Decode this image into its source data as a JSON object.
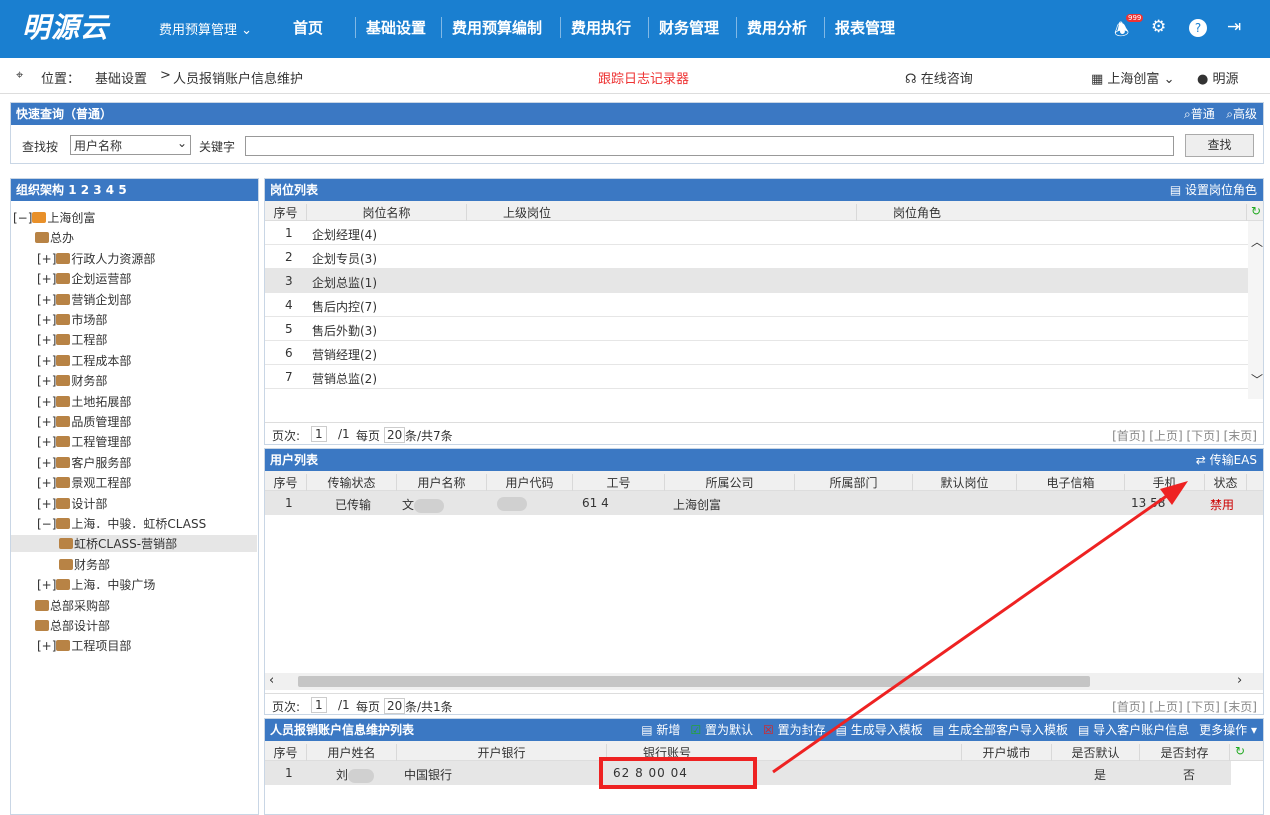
{
  "header": {
    "logo": "明源云",
    "module_menu": "费用预算管理",
    "nav": [
      "首页",
      "基础设置",
      "费用预算编制",
      "费用执行",
      "财务管理",
      "费用分析",
      "报表管理"
    ],
    "notification_count": "999",
    "icons": [
      "bell-icon",
      "gear-icon",
      "help-icon",
      "logout-icon"
    ]
  },
  "location": {
    "label": "位置：",
    "crumb1": "基础设置",
    "sep": ">",
    "crumb2": "人员报销账户信息维护",
    "log_link": "跟踪日志记录器",
    "consult": "在线咨询",
    "company": "上海创富",
    "user": "明源"
  },
  "quick": {
    "title": "快速查询（普通）",
    "normal": "普通",
    "advanced": "高级",
    "search_by": "查找按",
    "search_field": "用户名称",
    "keyword": "关键字",
    "keyword_value": "",
    "search_btn": "查找"
  },
  "org": {
    "title": "组织架构",
    "levels": "1 2 3 4 5",
    "tree": [
      {
        "label": "上海创富",
        "toggle": "[−]"
      },
      {
        "label": "总办",
        "toggle": ""
      },
      {
        "label": "行政人力资源部",
        "toggle": "[+]"
      },
      {
        "label": "企划运营部",
        "toggle": "[+]"
      },
      {
        "label": "营销企划部",
        "toggle": "[+]"
      },
      {
        "label": "市场部",
        "toggle": "[+]"
      },
      {
        "label": "工程部",
        "toggle": "[+]"
      },
      {
        "label": "工程成本部",
        "toggle": "[+]"
      },
      {
        "label": "财务部",
        "toggle": "[+]"
      },
      {
        "label": "土地拓展部",
        "toggle": "[+]"
      },
      {
        "label": "品质管理部",
        "toggle": "[+]"
      },
      {
        "label": "工程管理部",
        "toggle": "[+]"
      },
      {
        "label": "客户服务部",
        "toggle": "[+]"
      },
      {
        "label": "景观工程部",
        "toggle": "[+]"
      },
      {
        "label": "设计部",
        "toggle": "[+]"
      },
      {
        "label": "上海．中骏．虹桥CLASS",
        "toggle": "[−]"
      },
      {
        "label": "虹桥CLASS-营销部",
        "toggle": ""
      },
      {
        "label": "财务部",
        "toggle": ""
      },
      {
        "label": "上海．中骏广场",
        "toggle": "[+]"
      },
      {
        "label": "总部采购部",
        "toggle": ""
      },
      {
        "label": "总部设计部",
        "toggle": ""
      },
      {
        "label": "工程项目部",
        "toggle": "[+]"
      }
    ]
  },
  "positions": {
    "title": "岗位列表",
    "action": "设置岗位角色",
    "columns": [
      "序号",
      "岗位名称",
      "上级岗位",
      "岗位角色"
    ],
    "rows": [
      {
        "no": "1",
        "name": "企划经理(4)"
      },
      {
        "no": "2",
        "name": "企划专员(3)"
      },
      {
        "no": "3",
        "name": "企划总监(1)"
      },
      {
        "no": "4",
        "name": "售后内控(7)"
      },
      {
        "no": "5",
        "name": "售后外勤(3)"
      },
      {
        "no": "6",
        "name": "营销经理(2)"
      },
      {
        "no": "7",
        "name": "营销总监(2)"
      }
    ],
    "pager": {
      "label": "页次:",
      "page": "1",
      "total_pages": "/1",
      "per_label": "每页",
      "per": "20",
      "summary": "条/共7条",
      "links": "[首页] [上页] [下页] [末页]"
    }
  },
  "users": {
    "title": "用户列表",
    "action": "传输EAS",
    "columns": [
      "序号",
      "传输状态",
      "用户名称",
      "用户代码",
      "工号",
      "所属公司",
      "所属部门",
      "默认岗位",
      "电子信箱",
      "手机",
      "状态"
    ],
    "rows": [
      {
        "no": "1",
        "transfer": "已传输",
        "name": "文",
        "code": "",
        "jobno": "61  4",
        "company": "上海创富",
        "phone": "13   58",
        "status": "禁用"
      }
    ],
    "pager": {
      "label": "页次:",
      "page": "1",
      "total_pages": "/1",
      "per_label": "每页",
      "per": "20",
      "summary": "条/共1条",
      "links": "[首页] [上页] [下页] [末页]"
    }
  },
  "accounts": {
    "title": "人员报销账户信息维护列表",
    "actions": [
      "新增",
      "置为默认",
      "置为封存",
      "生成导入模板",
      "生成全部客户导入模板",
      "导入客户账户信息",
      "更多操作"
    ],
    "columns": [
      "序号",
      "用户姓名",
      "开户银行",
      "银行账号",
      "开户城市",
      "是否默认",
      "是否封存"
    ],
    "rows": [
      {
        "no": "1",
        "name": "刘",
        "bank": "中国银行",
        "account": "62  8  00  04",
        "city": "",
        "default": "是",
        "sealed": "否"
      }
    ]
  },
  "colors": {
    "brand": "#1a7fd0",
    "panel_head": "#3b78c3",
    "highlight": "#ee2222"
  }
}
